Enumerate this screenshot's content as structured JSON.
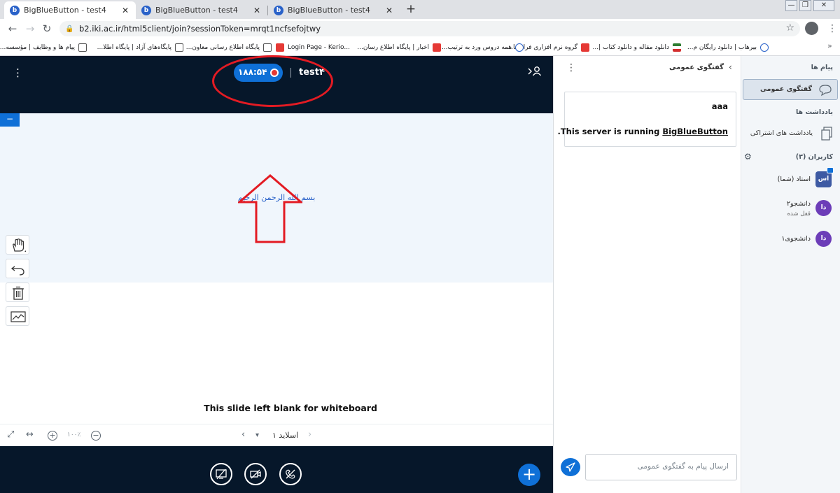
{
  "browser": {
    "tabs": [
      {
        "title": "BigBlueButton - test4",
        "close": "✕"
      },
      {
        "title": "BigBlueButton - test4",
        "close": "✕"
      },
      {
        "title": "BigBlueButton - test4",
        "close": "✕"
      }
    ],
    "new_tab": "+",
    "window_buttons": [
      "—",
      "❐",
      "✕"
    ],
    "url": "b2.iki.ac.ir/html5client/join?sessionToken=mrqt1ncfsefojtwy",
    "bookmarks": [
      "بیرهاب | دانلود رایگان م...",
      "دانلود مقاله و دانلود کتاب |...",
      "گروه نرم افزاری فرازسا...",
      "همه دروس ورد به ترتیب...",
      "اخبار | پایگاه اطلاع رسان...",
      "Login Page - Kerio...",
      "پایگاه اطلاع رسانی معاون...",
      "پایگاه‌های آزاد | پایگاه اطلا...",
      "پیام ها و وظایف | مؤسسه..."
    ],
    "more": "»"
  },
  "presentation": {
    "timer": "۱۸۸:۵۴",
    "meeting_name": "test۴",
    "minimize": "−",
    "slide_text": "بسم الله الرحمن الرحیم",
    "slide_caption": "This slide left blank for whiteboard",
    "zoom": "۱۰۰٪",
    "slide_label": "اسلاید ۱"
  },
  "chat": {
    "title": "گفتگوی عمومی",
    "message_author": "aaa",
    "message_prefix": ".This server is running ",
    "message_link": "BigBlueButton",
    "input_placeholder": "ارسال پیام به گفتگوی عمومی"
  },
  "userlist": {
    "messages_heading": "پیام ها",
    "public_chat": "گفتگوی عمومی",
    "notes_heading": "یادداشت ها",
    "shared_notes": "یادداشت های اشتراکی",
    "users_heading": "کاربران (۳)",
    "users": [
      {
        "initials": "اس",
        "name": "استاد (شما)",
        "sub": ""
      },
      {
        "initials": "دا",
        "name": "دانشجو۲",
        "sub": "قفل شده"
      },
      {
        "initials": "دا",
        "name": "دانشجوی۱",
        "sub": ""
      }
    ]
  },
  "colors": {
    "header_dark": "#06172a",
    "accent_blue": "#0f70d7",
    "annotation_red": "#e31b23"
  }
}
